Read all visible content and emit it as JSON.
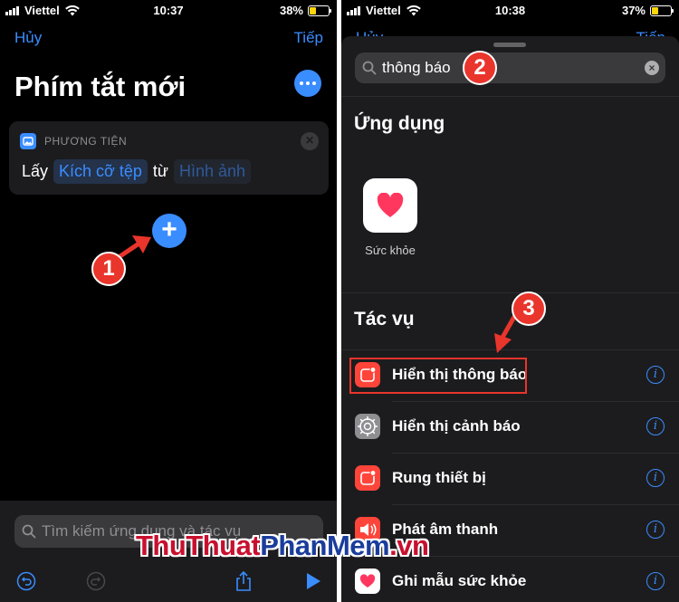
{
  "colors": {
    "accent": "#3a8dff",
    "annotation": "#e9352b",
    "battery": "#ffd60a"
  },
  "left": {
    "status": {
      "carrier": "Viettel",
      "time": "10:37",
      "battery": "38%",
      "battery_level": 0.38
    },
    "nav": {
      "cancel": "Hủy",
      "next": "Tiếp"
    },
    "title": "Phím tắt mới",
    "action": {
      "category": "PHƯƠNG TIỆN",
      "verb": "Lấy",
      "param": "Kích cỡ tệp",
      "preposition": "từ",
      "source": "Hình ảnh"
    },
    "search_placeholder": "Tìm kiếm ứng dụng và tác vụ",
    "toolbar_icons": [
      "undo-icon",
      "redo-icon",
      "share-icon",
      "play-icon"
    ]
  },
  "right": {
    "status": {
      "carrier": "Viettel",
      "time": "10:38",
      "battery": "37%",
      "battery_level": 0.37
    },
    "peek": {
      "cancel": "Hủy",
      "next": "Tiếp"
    },
    "search_value": "thông báo",
    "apps_section": "Ứng dụng",
    "apps": [
      {
        "name": "Sức khỏe",
        "icon": "heart-icon"
      }
    ],
    "actions_section": "Tác vụ",
    "actions": [
      {
        "label": "Hiển thị thông báo",
        "icon": "notification-icon"
      },
      {
        "label": "Hiển thị cảnh báo",
        "icon": "gear-icon"
      },
      {
        "label": "Rung thiết bị",
        "icon": "notification-icon"
      },
      {
        "label": "Phát âm thanh",
        "icon": "speaker-icon"
      },
      {
        "label": "Ghi mẫu sức khỏe",
        "icon": "heart-icon"
      }
    ]
  },
  "annotations": [
    "1",
    "2",
    "3"
  ],
  "watermark": {
    "part1": "ThuThuat",
    "part2": "PhanMem",
    "part3": ".vn"
  }
}
